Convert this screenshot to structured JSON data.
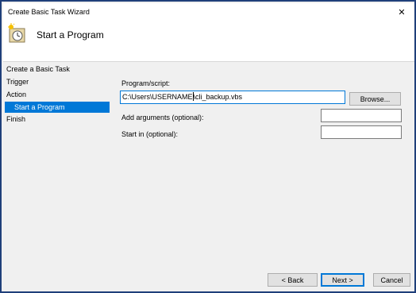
{
  "window": {
    "title": "Create Basic Task Wizard",
    "close_glyph": "✕"
  },
  "header": {
    "title": "Start a Program",
    "icon": "task-clock-icon"
  },
  "nav": {
    "items": [
      {
        "label": "Create a Basic Task"
      },
      {
        "label": "Trigger"
      },
      {
        "label": "Action"
      },
      {
        "label": "Start a Program",
        "selected": true
      },
      {
        "label": "Finish"
      }
    ]
  },
  "form": {
    "program_label": "Program/script:",
    "program_value_before_caret": "C:\\Users\\USERNAME",
    "program_value_after_caret": "\\cli_backup.vbs",
    "browse_label": "Browse...",
    "arguments_label": "Add arguments (optional):",
    "arguments_value": "",
    "start_in_label": "Start in (optional):",
    "start_in_value": ""
  },
  "footer": {
    "back_label": "< Back",
    "next_label": "Next >",
    "cancel_label": "Cancel"
  },
  "colors": {
    "selection": "#0078d7",
    "frame_border": "#1f3f7a",
    "dialog_bg": "#f0f0f0"
  }
}
